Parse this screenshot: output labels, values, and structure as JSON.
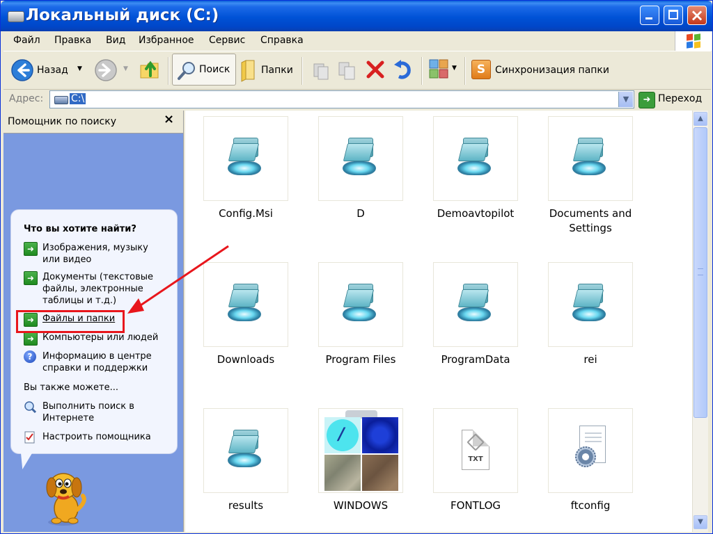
{
  "window": {
    "title": "Локальный диск (C:)"
  },
  "menu": {
    "items": [
      "Файл",
      "Правка",
      "Вид",
      "Избранное",
      "Сервис",
      "Справка"
    ]
  },
  "toolbar": {
    "back_label": "Назад",
    "search_label": "Поиск",
    "folders_label": "Папки",
    "sync_label": "Синхронизация папки"
  },
  "address": {
    "label": "Адрес:",
    "value": "C:\\",
    "go_label": "Переход"
  },
  "search_assistant": {
    "title": "Помощник по поиску",
    "close": "×",
    "question": "Что вы хотите найти?",
    "options": [
      "Изображения, музыку или видео",
      "Документы (текстовые файлы, электронные таблицы и т.д.)",
      "Файлы и папки",
      "Компьютеры или людей",
      "Информацию в центре справки и поддержки"
    ],
    "also_label": "Вы также можете...",
    "also_options": [
      "Выполнить поиск в Интернете",
      "Настроить помощника"
    ]
  },
  "files": [
    {
      "name": "Config.Msi",
      "type": "folder"
    },
    {
      "name": "D",
      "type": "folder"
    },
    {
      "name": "Demoavtopilot",
      "type": "folder"
    },
    {
      "name": "Documents and Settings",
      "type": "folder"
    },
    {
      "name": "Downloads",
      "type": "folder"
    },
    {
      "name": "Program Files",
      "type": "folder"
    },
    {
      "name": "ProgramData",
      "type": "folder"
    },
    {
      "name": "rei",
      "type": "folder"
    },
    {
      "name": "results",
      "type": "folder"
    },
    {
      "name": "WINDOWS",
      "type": "folder-thumbnails"
    },
    {
      "name": "FONTLOG",
      "type": "txt"
    },
    {
      "name": "ftconfig",
      "type": "config"
    }
  ],
  "doc_icon_text": "TXT",
  "colors": {
    "titlebar": "#0052d6",
    "assistant_panel": "#7a99e0",
    "highlight": "#e8161c"
  }
}
